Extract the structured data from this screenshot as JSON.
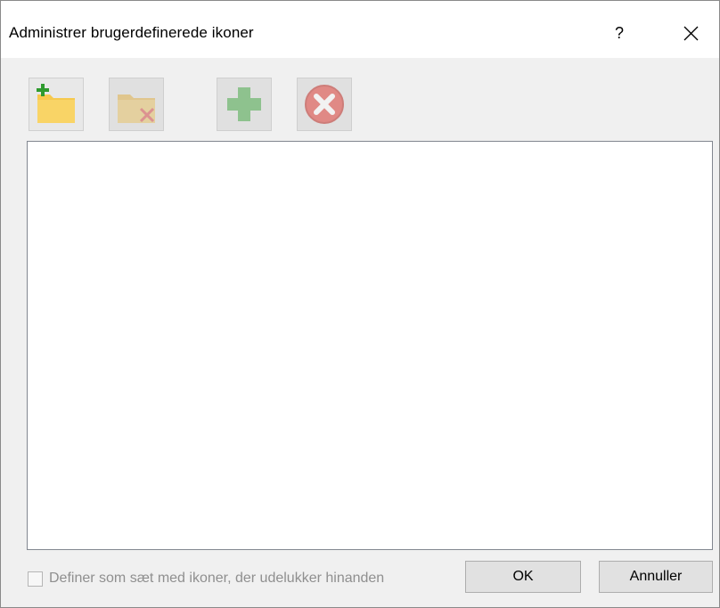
{
  "window": {
    "title": "Administrer brugerdefinerede ikoner",
    "help_label": "?",
    "close_icon": "close-icon"
  },
  "toolbar": {
    "buttons": [
      {
        "name": "new-folder",
        "icon": "folder-add-icon",
        "enabled": true
      },
      {
        "name": "delete-folder",
        "icon": "folder-delete-icon",
        "enabled": false
      },
      {
        "name": "add-icon",
        "icon": "plus-icon",
        "enabled": false
      },
      {
        "name": "remove-icon",
        "icon": "remove-circle-icon",
        "enabled": false
      }
    ]
  },
  "icon_list": {
    "items": []
  },
  "footer": {
    "mutually_exclusive_label": "Definer som sæt med ikoner, der udelukker hinanden",
    "mutually_exclusive_checked": false,
    "mutually_exclusive_enabled": false,
    "ok_label": "OK",
    "cancel_label": "Annuller"
  },
  "colors": {
    "folder": "#f6c94e",
    "plus_green": "#2e9a2e",
    "delete_red": "#d9534f"
  }
}
